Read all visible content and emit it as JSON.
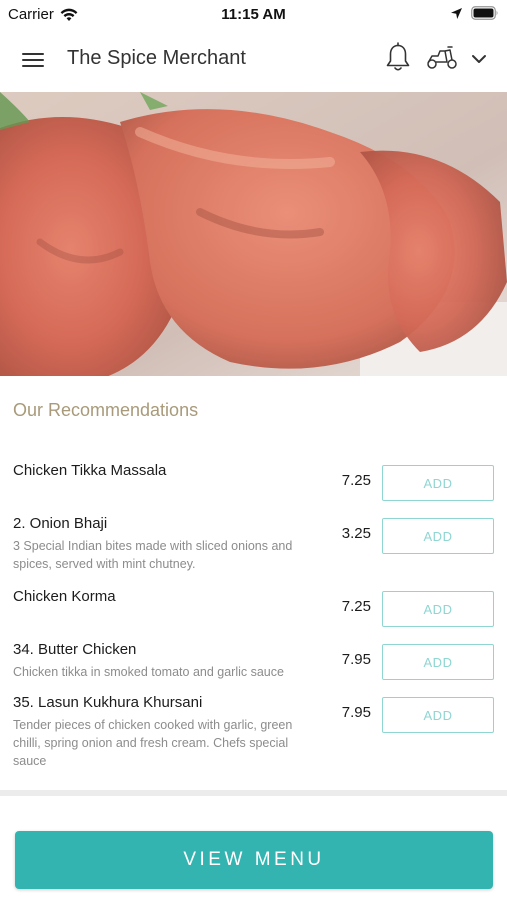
{
  "status_bar": {
    "carrier": "Carrier",
    "time": "11:15 AM",
    "icons": [
      "wifi-icon",
      "location-arrow-icon",
      "battery-icon"
    ]
  },
  "header": {
    "title": "The Spice Merchant",
    "icons": [
      "hamburger-menu-icon",
      "bell-icon",
      "scooter-icon",
      "chevron-down-icon"
    ]
  },
  "hero": {
    "image": "tandoori-lamb-chops-photo"
  },
  "recommendations": {
    "title": "Our Recommendations",
    "add_label": "ADD",
    "items": [
      {
        "name": "Chicken Tikka Massala",
        "description": "",
        "price": "7.25"
      },
      {
        "name": "2. Onion Bhaji",
        "description": "3 Special Indian bites made with sliced onions and spices, served with mint chutney.",
        "price": "3.25"
      },
      {
        "name": "Chicken Korma",
        "description": "",
        "price": "7.25"
      },
      {
        "name": "34. Butter Chicken",
        "description": "Chicken tikka in smoked tomato and garlic sauce",
        "price": "7.95"
      },
      {
        "name": "35. Lasun Kukhura Khursani",
        "description": "Tender pieces of chicken cooked with garlic, green chilli, spring onion and fresh cream. Chefs special sauce",
        "price": "7.95"
      }
    ]
  },
  "footer": {
    "view_menu_label": "VIEW MENU"
  },
  "colors": {
    "accent": "#33b4b1",
    "add_border": "#8fd6d2",
    "section_title": "#a89a7a",
    "description": "#8c8c8c"
  }
}
